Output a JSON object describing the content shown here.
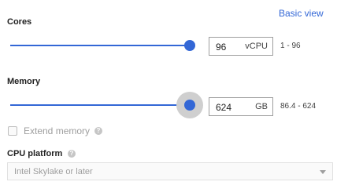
{
  "header": {
    "basic_view_link": "Basic view"
  },
  "cores": {
    "label": "Cores",
    "value": "96",
    "unit": "vCPU",
    "range": "1 - 96",
    "slider_fraction": 1.0
  },
  "memory": {
    "label": "Memory",
    "value": "624",
    "unit": "GB",
    "range": "86.4 - 624",
    "slider_fraction": 1.0
  },
  "extend_memory": {
    "label": "Extend memory",
    "checked": false,
    "help_icon": "help-icon"
  },
  "cpu_platform": {
    "label": "CPU platform",
    "help_icon": "help-icon",
    "selected": "Intel Skylake or later"
  },
  "colors": {
    "accent": "#3367d6",
    "track": "#bdbdbd",
    "halo": "#cfcfcf"
  }
}
